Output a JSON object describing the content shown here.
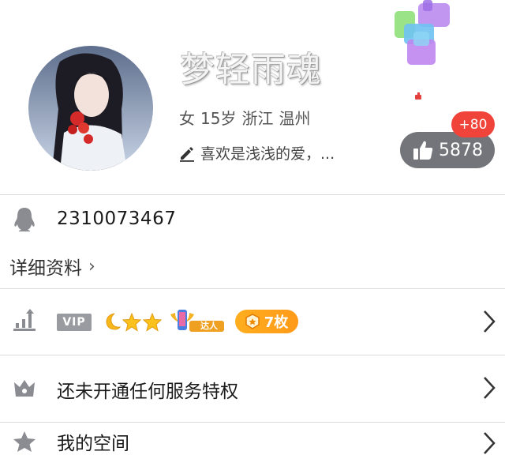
{
  "profile": {
    "nickname": "梦轻雨魂",
    "gender": "女",
    "age": "15岁",
    "province": "浙江",
    "city": "温州",
    "signature": "喜欢是浅浅的爱，...",
    "like_count": "5878",
    "like_increment": "+80",
    "avatar_icon": "avatar-photo"
  },
  "account": {
    "qq_number": "2310073467",
    "detail_label": "详细资料",
    "detail_chevron": "›"
  },
  "level_row": {
    "vip_label": "VIP",
    "medal_count": "7枚",
    "daren_label": "达人"
  },
  "service_row": {
    "label": "还未开通任何服务特权"
  },
  "space_row": {
    "label": "我的空间"
  },
  "colors": {
    "accent_orange": "#ff9a18",
    "badge_red": "#f0443a",
    "pill_gray": "#74757a",
    "icon_gray": "#8b8c92"
  }
}
